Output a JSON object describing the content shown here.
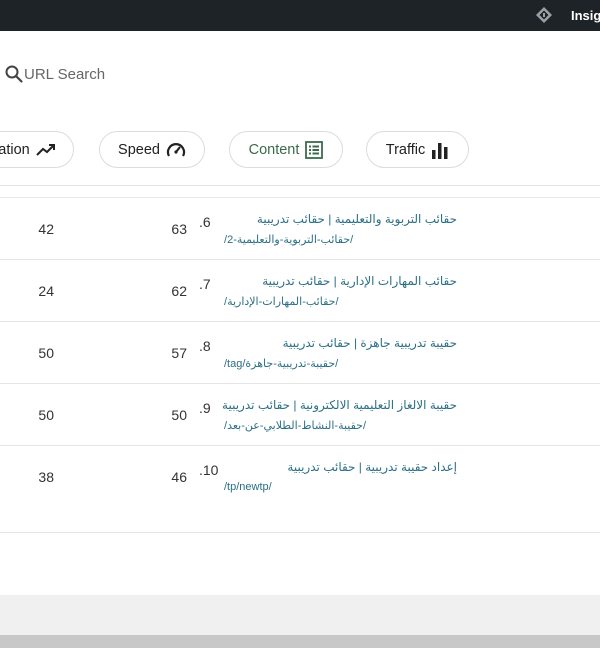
{
  "topbar": {
    "brand": "Insig",
    "logo_icon": "diamond-logo-icon"
  },
  "search": {
    "placeholder": "URL Search",
    "icon": "search-icon"
  },
  "tabs": [
    {
      "label": "ation",
      "icon": "trending-up-icon"
    },
    {
      "label": "Speed",
      "icon": "gauge-icon"
    },
    {
      "label": "Content",
      "icon": "list-box-icon",
      "active": true
    },
    {
      "label": "Traffic",
      "icon": "bar-chart-icon"
    }
  ],
  "rows": [
    {
      "col1": "42",
      "col2": "63",
      "rank": ".6",
      "title": "حقائب التربوية والتعليمية | حقائب تدريبية",
      "url": "/حقائب-التربوية-والتعليمية-2/"
    },
    {
      "col1": "24",
      "col2": "62",
      "rank": ".7",
      "title": "حقائب المهارات الإدارية | حقائب تدريبية",
      "url": "/حقائب-المهارات-الإدارية/"
    },
    {
      "col1": "50",
      "col2": "57",
      "rank": ".8",
      "title": "حقيبة تدريبية جاهزة | حقائب تدريبية",
      "url": "/tag/حقيبة-تدريبية-جاهزة/"
    },
    {
      "col1": "50",
      "col2": "50",
      "rank": ".9",
      "title": "حقيبة الالغاز التعليمية الالكترونية | حقائب تدريبية",
      "url": "/حقيبة-النشاط-الطلابي-عن-بعد/"
    },
    {
      "col1": "38",
      "col2": "46",
      "rank": ".10",
      "title": "إعداد حقيبة تدريبية | حقائب تدريبية",
      "url": "/tp/newtp/"
    }
  ],
  "colors": {
    "link": "#2b6f84",
    "topbar": "#1d2327",
    "active_tab": "#3b6b4c"
  }
}
